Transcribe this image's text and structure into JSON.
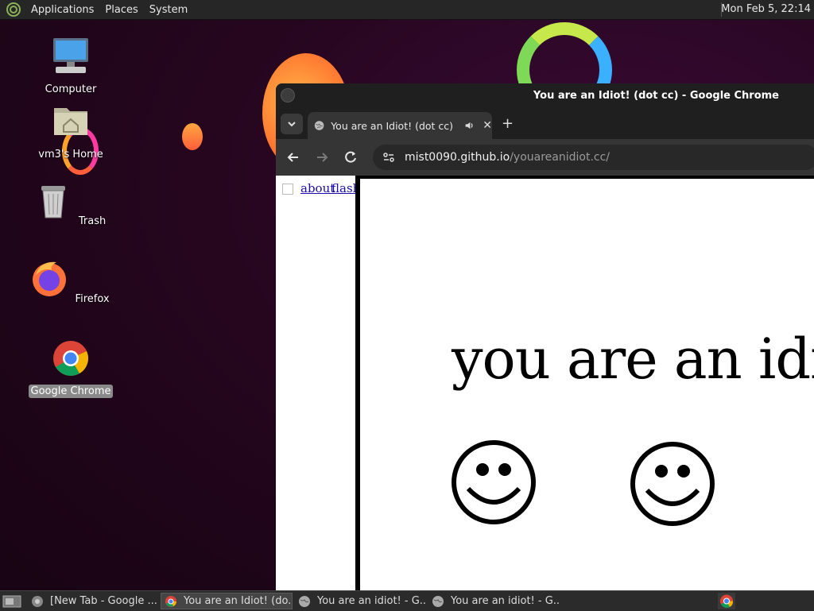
{
  "top_panel": {
    "menus": [
      "Applications",
      "Places",
      "System"
    ],
    "clock": "Mon Feb  5, 22:14"
  },
  "desktop": {
    "icons": [
      {
        "label": "Computer"
      },
      {
        "label": "vm3's Home"
      },
      {
        "label": "Trash"
      },
      {
        "label": "Firefox"
      },
      {
        "label": "Google Chrome"
      }
    ]
  },
  "window": {
    "title": "You are an Idiot! (dot cc) - Google Chrome",
    "tab_title": "You are an Idiot! (dot cc)",
    "url_host": "mist0090.github.io",
    "url_path": "/youareanidiot.cc/"
  },
  "page": {
    "links": [
      "about",
      "flash"
    ],
    "headline": "you are an idiot"
  },
  "taskbar": {
    "items": [
      "[New Tab - Google ...",
      "You are an Idiot! (do...",
      "You are an idiot! - G...",
      "You are an idiot! - G..."
    ]
  },
  "colors": {
    "desktop_bg": "#26061f",
    "panel_bg": "#262626",
    "chrome_dark": "#1f1f1f",
    "link": "#1a0dab"
  }
}
